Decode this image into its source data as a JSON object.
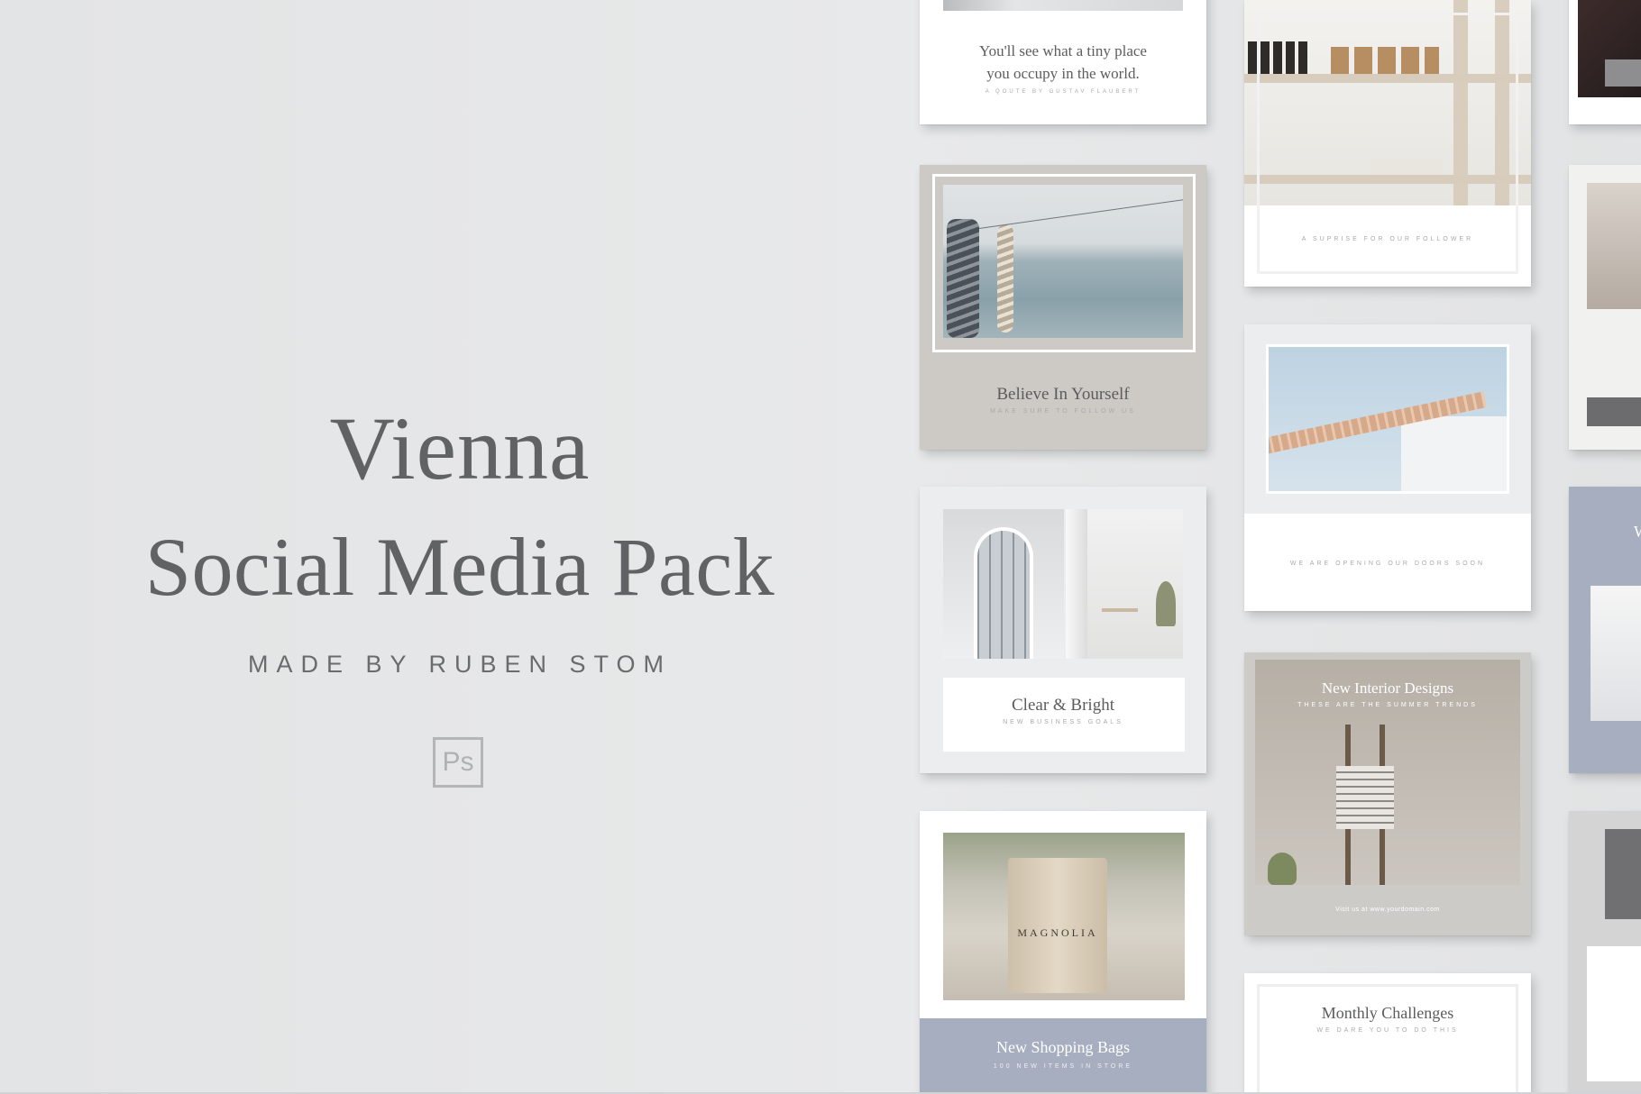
{
  "hero": {
    "title_line1": "Vienna",
    "title_line2": "Social Media Pack",
    "byline": "MADE BY RUBEN STOM",
    "ps_badge": "Ps"
  },
  "cards": {
    "quote": {
      "text_line1": "You'll see what a tiny place",
      "text_line2": "you occupy in the world.",
      "attribution": "A QOUTE BY GUSTAV FLAUBERT"
    },
    "believe": {
      "title": "Believe In Yourself",
      "subtitle": "MAKE SURE TO FOLLOW US"
    },
    "clear": {
      "title": "Clear & Bright",
      "subtitle": "NEW BUSINESS GOALS"
    },
    "bags": {
      "title": "New Shopping Bags",
      "subtitle": "100 NEW ITEMS IN STORE",
      "bag_text": "MAGNOLIA"
    },
    "shelf": {
      "subtitle": "A SUPRISE FOR OUR FOLLOWER"
    },
    "roof": {
      "subtitle": "WE ARE OPENING OUR DOORS SOON"
    },
    "interior": {
      "title": "New Interior Designs",
      "subtitle": "THESE ARE THE SUMMER TRENDS",
      "footer": "Visit us at www.yourdomain.com"
    },
    "monthly": {
      "title": "Monthly Challenges",
      "subtitle": "WE DARE YOU TO DO THIS"
    },
    "partial_blue": {
      "letter": "W"
    }
  },
  "colors": {
    "background": "#e6e7e8",
    "title_text": "#616263",
    "card_gray": "#cdcac6",
    "card_blue": "#a6aec0",
    "card_taupe": "#b7b0a7"
  },
  "icons": [
    "photoshop-icon"
  ]
}
